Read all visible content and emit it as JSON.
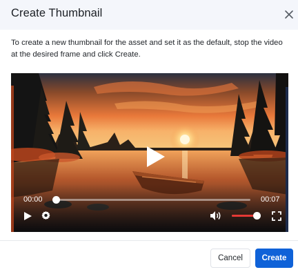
{
  "dialog": {
    "title": "Create Thumbnail",
    "description": "To create a new thumbnail for the asset and set it as the default, stop the video at the desired frame and click Create."
  },
  "player": {
    "current_time": "00:00",
    "duration": "00:07",
    "progress": 0.0,
    "volume": 0.85,
    "icons": [
      "play-icon",
      "settings-icon",
      "volume-icon",
      "fullscreen-icon",
      "big-play-icon"
    ]
  },
  "footer": {
    "cancel_label": "Cancel",
    "create_label": "Create"
  },
  "colors": {
    "accent": "#0f62d8",
    "volume_fill": "#e53935",
    "header_bg": "#f4f6fb"
  }
}
